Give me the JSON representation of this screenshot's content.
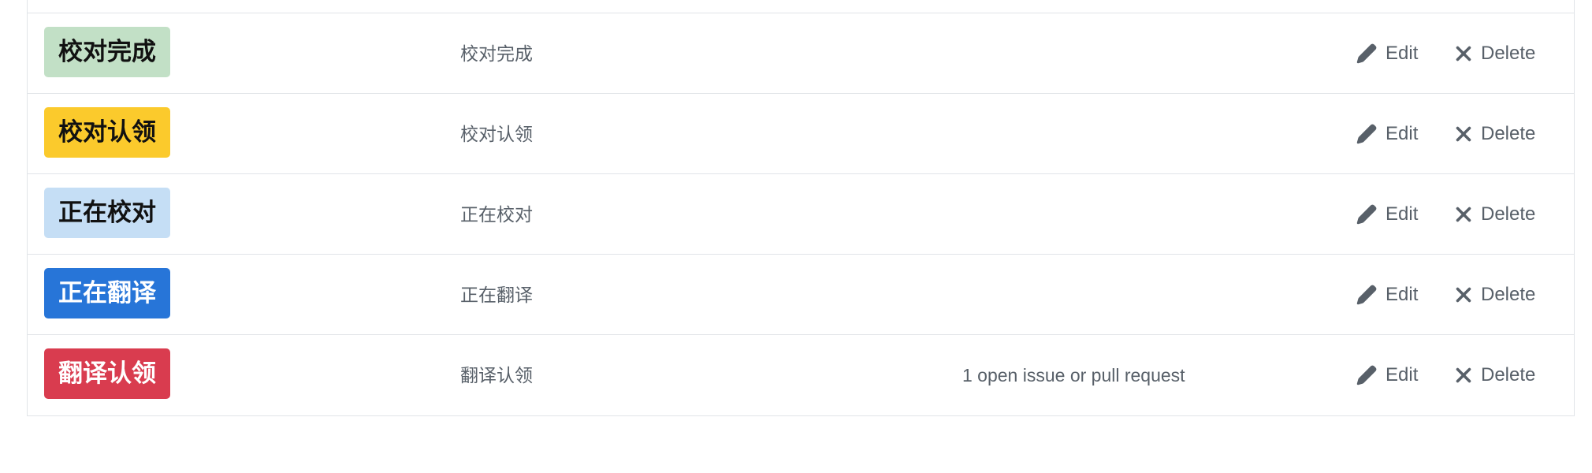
{
  "labels": [
    {
      "name": "校对完成",
      "description": "校对完成",
      "issues": "",
      "color": "#c2e0c6",
      "text_color": "#111111"
    },
    {
      "name": "校对认领",
      "description": "校对认领",
      "issues": "",
      "color": "#fbca2c",
      "text_color": "#111111"
    },
    {
      "name": "正在校对",
      "description": "正在校对",
      "issues": "",
      "color": "#c5def5",
      "text_color": "#111111"
    },
    {
      "name": "正在翻译",
      "description": "正在翻译",
      "issues": "",
      "color": "#2775d8",
      "text_color": "#ffffff"
    },
    {
      "name": "翻译认领",
      "description": "翻译认领",
      "issues": "1 open issue or pull request",
      "color": "#d93c4f",
      "text_color": "#ffffff"
    }
  ],
  "actions": {
    "edit_label": "Edit",
    "delete_label": "Delete",
    "edit_icon": "pencil-icon",
    "delete_icon": "x-icon"
  }
}
